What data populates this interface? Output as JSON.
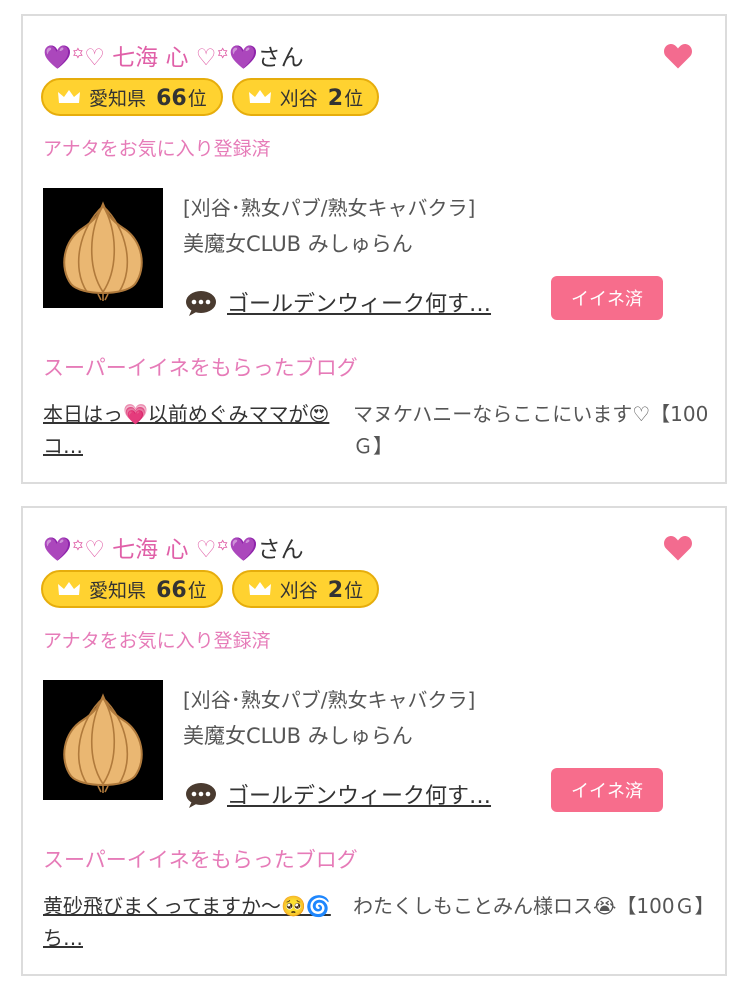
{
  "cards": [
    {
      "name_prefix": "💜꙳♡ 七海 心 ♡꙳💜",
      "name_suffix": "さん",
      "ranks": [
        {
          "area": "愛知県",
          "rank": "66",
          "unit": "位"
        },
        {
          "area": "刈谷",
          "rank": "2",
          "unit": "位"
        }
      ],
      "favorite_status": "アナタをお気に入り登録済",
      "store_category": "[刈谷･熟女パブ/熟女キャバクラ]",
      "store_name": "美魔女CLUB みしゅらん",
      "blog_title": "ゴールデンウィーク何す…",
      "liked_label": "イイネ済",
      "super_section": "スーパーイイネをもらったブログ",
      "super_blog_title": "本日はっ💗以前めぐみママが😍コ…",
      "super_blog_note": "マヌケハニーならここにいます♡【100Ｇ】"
    },
    {
      "name_prefix": "💜꙳♡ 七海 心 ♡꙳💜",
      "name_suffix": "さん",
      "ranks": [
        {
          "area": "愛知県",
          "rank": "66",
          "unit": "位"
        },
        {
          "area": "刈谷",
          "rank": "2",
          "unit": "位"
        }
      ],
      "favorite_status": "アナタをお気に入り登録済",
      "store_category": "[刈谷･熟女パブ/熟女キャバクラ]",
      "store_name": "美魔女CLUB みしゅらん",
      "blog_title": "ゴールデンウィーク何す…",
      "liked_label": "イイネ済",
      "super_section": "スーパーイイネをもらったブログ",
      "super_blog_title": "黄砂飛びまくってますか〜🥺🌀ち…",
      "super_blog_note": "わたくしもことみん様ロス😭【100Ｇ】"
    }
  ],
  "colors": {
    "pink_text": "#e67bb8",
    "heart": "#f36b8f",
    "rank_badge": "#ffd230",
    "liked_button": "#f76d8c"
  },
  "icons": [
    "heart-icon",
    "crown-icon",
    "onion-thumbnail",
    "comment-bubble-icon"
  ]
}
